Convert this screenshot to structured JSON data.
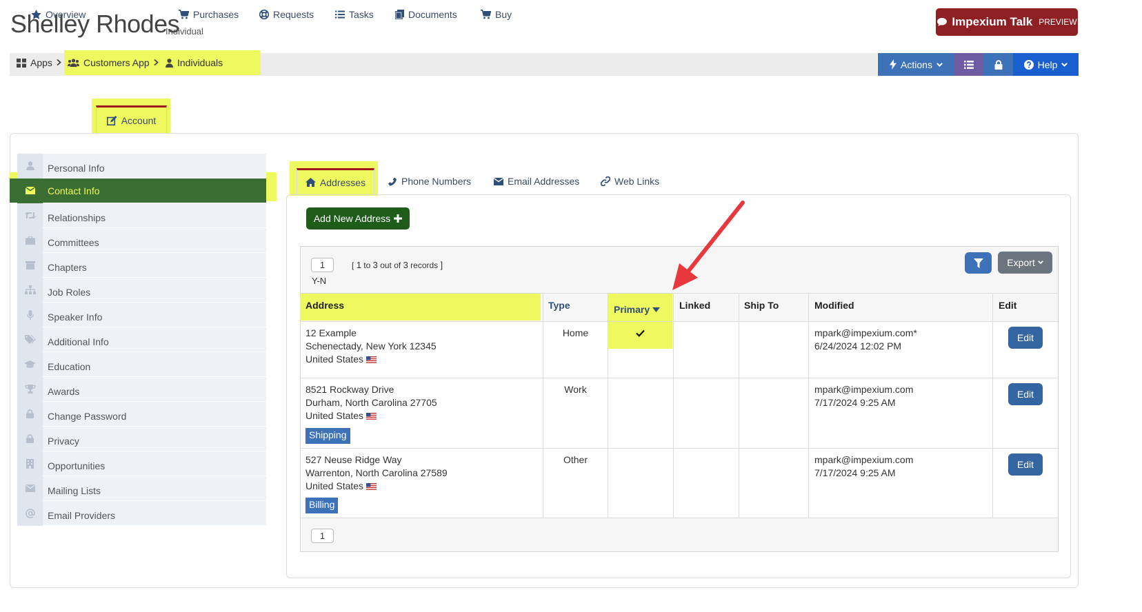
{
  "header": {
    "title": "Shelley Rhodes",
    "subtitle": "Individual",
    "talk_button": {
      "label": "Impexium Talk",
      "badge": "PREVIEW"
    }
  },
  "breadcrumb": [
    {
      "label": "Apps",
      "icon": "grid-icon"
    },
    {
      "label": "Customers App",
      "icon": "users-icon"
    },
    {
      "label": "Individuals",
      "icon": "user-icon"
    }
  ],
  "toolbar": {
    "actions_label": "Actions",
    "help_label": "Help"
  },
  "top_tabs": [
    {
      "label": "Overview",
      "icon": "star-icon"
    },
    {
      "label": "Account",
      "icon": "edit-icon",
      "active": true
    },
    {
      "label": "Purchases",
      "icon": "cart-icon"
    },
    {
      "label": "Requests",
      "icon": "lifebuoy-icon"
    },
    {
      "label": "Tasks",
      "icon": "list-icon"
    },
    {
      "label": "Documents",
      "icon": "documents-icon"
    },
    {
      "label": "Buy",
      "icon": "cart-icon"
    }
  ],
  "sidebar": {
    "items": [
      {
        "label": "Personal Info",
        "icon": "user-icon"
      },
      {
        "label": "Contact Info",
        "icon": "envelope-icon",
        "active": true
      },
      {
        "label": "Relationships",
        "icon": "retweet-icon"
      },
      {
        "label": "Committees",
        "icon": "briefcase-icon"
      },
      {
        "label": "Chapters",
        "icon": "archive-icon"
      },
      {
        "label": "Job Roles",
        "icon": "sitemap-icon"
      },
      {
        "label": "Speaker Info",
        "icon": "microphone-icon"
      },
      {
        "label": "Additional Info",
        "icon": "tags-icon"
      },
      {
        "label": "Education",
        "icon": "graduation-cap-icon"
      },
      {
        "label": "Awards",
        "icon": "trophy-icon"
      },
      {
        "label": "Change Password",
        "icon": "lock-icon"
      },
      {
        "label": "Privacy",
        "icon": "lock-icon"
      },
      {
        "label": "Opportunities",
        "icon": "building-icon"
      },
      {
        "label": "Mailing Lists",
        "icon": "envelope-icon"
      },
      {
        "label": "Email Providers",
        "icon": "at-icon"
      }
    ]
  },
  "sub_tabs": [
    {
      "label": "Addresses",
      "icon": "home-icon",
      "active": true
    },
    {
      "label": "Phone Numbers",
      "icon": "phone-icon"
    },
    {
      "label": "Email Addresses",
      "icon": "envelope-icon"
    },
    {
      "label": "Web Links",
      "icon": "link-icon"
    }
  ],
  "addresses": {
    "add_button": "Add New Address",
    "pager": {
      "page": "1",
      "bracket_open": "[",
      "from": "1",
      "to_word": "to",
      "to": "3",
      "out_of_word": "out of",
      "total": "3",
      "records_word": "records",
      "bracket_close": "]",
      "sort_label": "Y-N"
    },
    "export_label": "Export",
    "columns": [
      "Address",
      "Type",
      "Primary",
      "Linked",
      "Ship To",
      "Modified",
      "Edit"
    ],
    "rows": [
      {
        "line1": "12 Example",
        "line2": "Schenectady, New York 12345",
        "country": "United States",
        "tag": "",
        "type": "Home",
        "primary": true,
        "modified_by": "mpark@impexium.com*",
        "modified_at": "6/24/2024 12:02 PM",
        "edit_label": "Edit"
      },
      {
        "line1": "8521 Rockway Drive",
        "line2": "Durham, North Carolina 27705",
        "country": "United States",
        "tag": "Shipping",
        "type": "Work",
        "primary": false,
        "modified_by": "mpark@impexium.com",
        "modified_at": "7/17/2024 9:25 AM",
        "edit_label": "Edit"
      },
      {
        "line1": "527 Neuse Ridge Way",
        "line2": "Warrenton, North Carolina 27589",
        "country": "United States",
        "tag": "Billing",
        "type": "Other",
        "primary": false,
        "modified_by": "mpark@impexium.com",
        "modified_at": "7/17/2024 9:25 AM",
        "edit_label": "Edit"
      }
    ],
    "bottom_page": "1"
  },
  "colors": {
    "highlight": "#eef85f",
    "primary_blue": "#3d71b8",
    "green": "#1f5c1a",
    "sidebar_active": "#3a6e33",
    "talk_red": "#8e1f23",
    "annotation_arrow": "#e8383d"
  }
}
